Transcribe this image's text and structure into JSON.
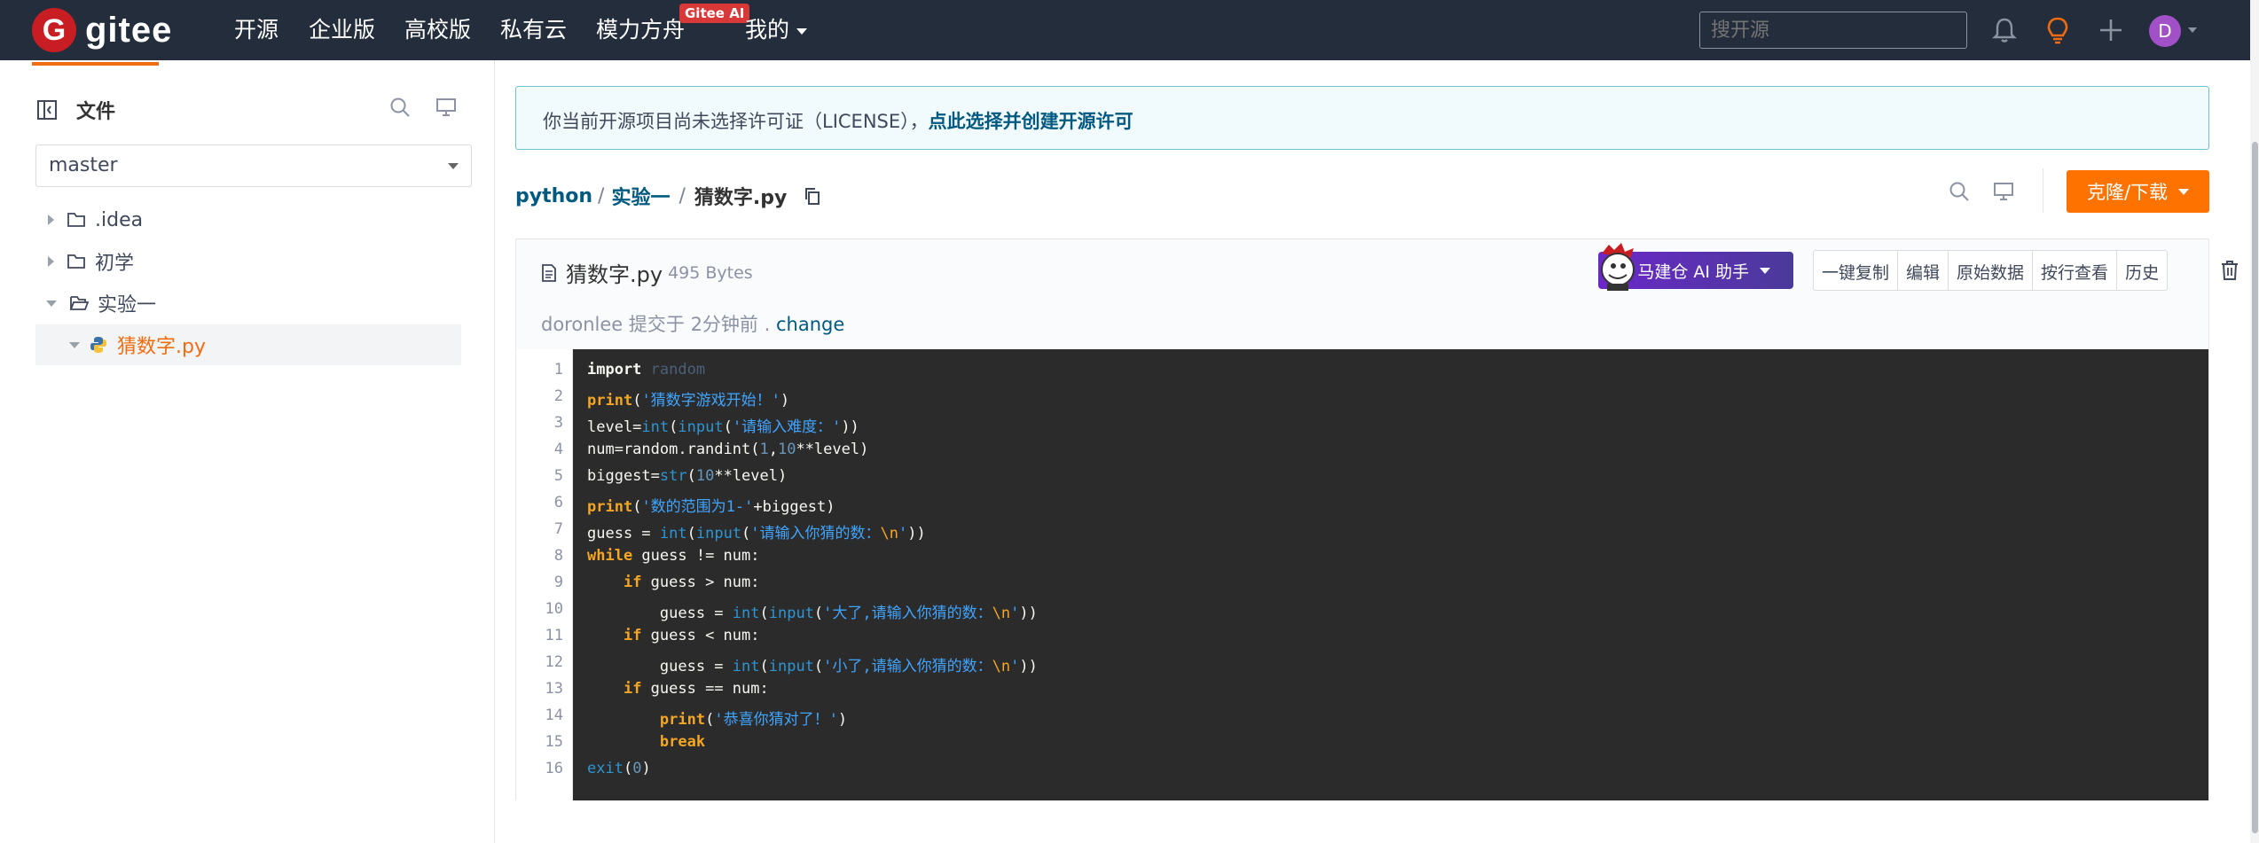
{
  "brand": {
    "logo_letter": "G",
    "name": "gitee"
  },
  "nav": {
    "items": [
      "开源",
      "企业版",
      "高校版",
      "私有云",
      "模力方舟"
    ],
    "ai_badge": "Gitee AI",
    "mine": "我的",
    "search_placeholder": "搜开源",
    "avatar_letter": "D"
  },
  "sidebar": {
    "title": "文件",
    "branch": "master",
    "tree": [
      {
        "label": ".idea"
      },
      {
        "label": "初学"
      },
      {
        "label": "实验一"
      },
      {
        "label": "猜数字.py"
      }
    ]
  },
  "license": {
    "text": "你当前开源项目尚未选择许可证（LICENSE），",
    "link": "点此选择并创建开源许可"
  },
  "breadcrumb": {
    "repo": "python",
    "folder": "实验一",
    "file": "猜数字.py",
    "sep": "/"
  },
  "clone_button": "克隆/下载",
  "file": {
    "name": "猜数字.py",
    "size": "495 Bytes",
    "ai_helper": "马建仓 AI 助手",
    "actions": [
      "一键复制",
      "编辑",
      "原始数据",
      "按行查看",
      "历史"
    ],
    "commit": {
      "author": "doronlee",
      "text": "提交于",
      "time": "2分钟前",
      "dot": ".",
      "link": "change"
    }
  },
  "code": {
    "line_numbers": [
      "1",
      "2",
      "3",
      "4",
      "5",
      "6",
      "7",
      "8",
      "9",
      "10",
      "11",
      "12",
      "13",
      "14",
      "15",
      "16"
    ],
    "lines": [
      "import random",
      "print('猜数字游戏开始！')",
      "level=int(input('请输入难度：'))",
      "num=random.randint(1,10**level)",
      "biggest=str(10**level)",
      "print('数的范围为1-'+biggest)",
      "guess = int(input('请输入你猜的数：\\n'))",
      "while guess != num:",
      "    if guess > num:",
      "        guess = int(input('大了,请输入你猜的数：\\n'))",
      "    if guess < num:",
      "        guess = int(input('小了,请输入你猜的数：\\n'))",
      "    if guess == num:",
      "        print('恭喜你猜对了！')",
      "        break",
      "exit(0)"
    ]
  },
  "colors": {
    "brand_red": "#c71d23",
    "accent_orange": "#fe7300",
    "link_blue": "#005980",
    "nav_bg": "#232d3b",
    "code_bg": "#2b2b2b"
  }
}
